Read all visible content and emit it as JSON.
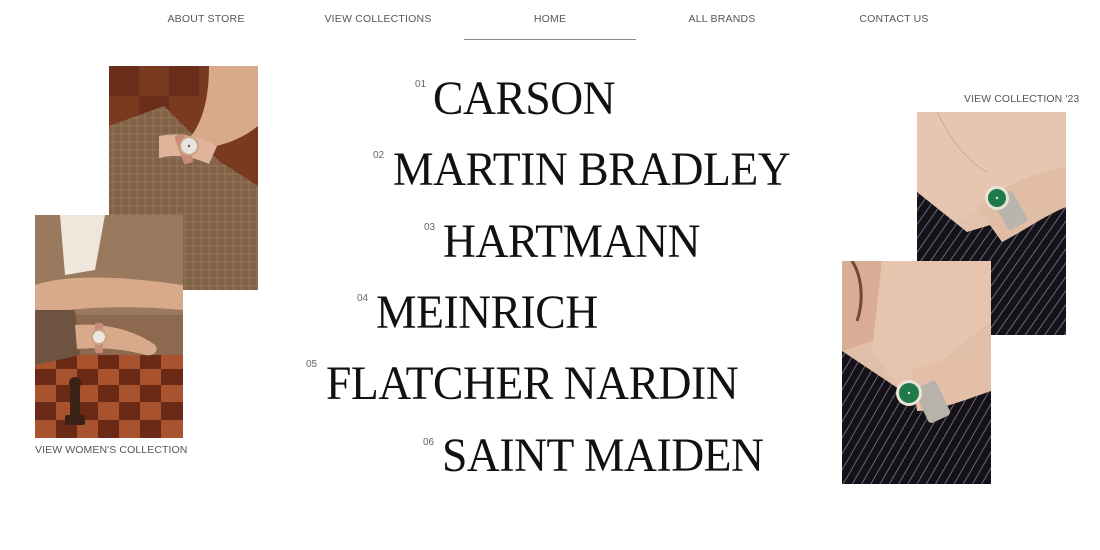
{
  "nav": {
    "items": [
      {
        "label": "ABOUT STORE"
      },
      {
        "label": "VIEW COLLECTIONS"
      },
      {
        "label": "HOME"
      },
      {
        "label": "ALL BRANDS"
      },
      {
        "label": "CONTACT US"
      }
    ],
    "active": "HOME"
  },
  "left": {
    "caption": "VIEW WOMEN'S COLLECTION"
  },
  "right": {
    "caption": "VIEW COLLECTION '23"
  },
  "brands": [
    {
      "num": "01",
      "name": "CARSON"
    },
    {
      "num": "02",
      "name": "MARTIN BRADLEY"
    },
    {
      "num": "03",
      "name": "HARTMANN"
    },
    {
      "num": "04",
      "name": "MEINRICH"
    },
    {
      "num": "05",
      "name": "FLATCHER NARDIN"
    },
    {
      "num": "06",
      "name": "SAINT MAIDEN"
    }
  ],
  "colors": {
    "text": "#111111",
    "muted": "#555555",
    "underline": "#8a8a8a",
    "chessboard_dark": "#6b2a15",
    "chessboard_light": "#a8532d",
    "jacket_dark": "#141218",
    "watch_dial_green": "#1f7a4a"
  }
}
